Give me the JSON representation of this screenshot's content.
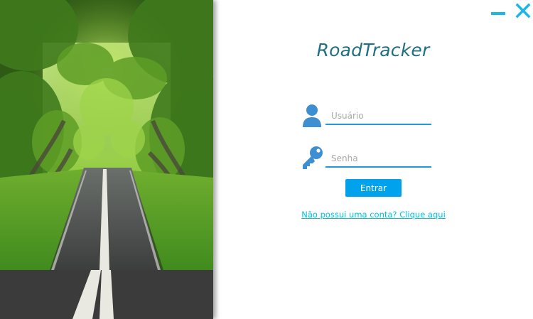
{
  "app": {
    "title": "RoadTracker"
  },
  "window_controls": {
    "minimize_icon": "minimize-icon",
    "close_icon": "close-icon"
  },
  "login": {
    "username_placeholder": "Usuário",
    "password_placeholder": "Senha",
    "username_value": "",
    "password_value": "",
    "submit_label": "Entrar",
    "signup_link": "Não possui uma conta? Clique aqui"
  },
  "colors": {
    "accent": "#00a2ed",
    "title": "#1f6f86",
    "link": "#00c2e0",
    "icon": "#3d8fd1",
    "window_controls": "#1ab8e6"
  },
  "images": {
    "side_photo": "tree-lined-road-photo"
  }
}
